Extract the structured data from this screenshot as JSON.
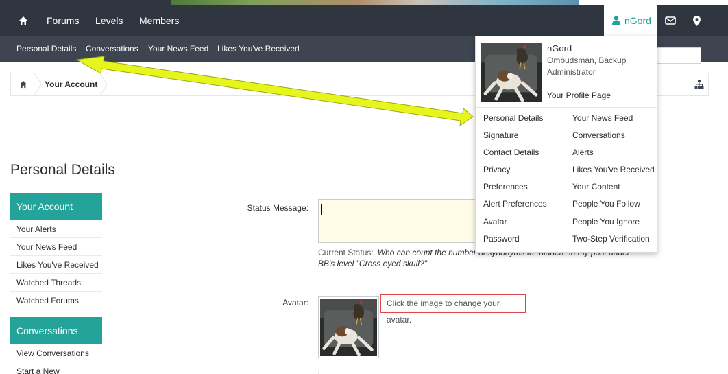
{
  "nav": {
    "items": [
      "Forums",
      "Levels",
      "Members"
    ],
    "user": "nGord"
  },
  "subnav": {
    "items": [
      "Personal Details",
      "Conversations",
      "Your News Feed",
      "Likes You've Received"
    ]
  },
  "breadcrumb": {
    "label": "Your Account"
  },
  "page": {
    "title": "Personal Details"
  },
  "sidebar": {
    "account": {
      "header": "Your Account",
      "links": [
        "Your Alerts",
        "Your News Feed",
        "Likes You've Received",
        "Watched Threads",
        "Watched Forums"
      ]
    },
    "conversations": {
      "header": "Conversations",
      "links": [
        "View Conversations",
        "Start a New"
      ]
    }
  },
  "form": {
    "status_label": "Status Message:",
    "status_value": "",
    "current_status_label": "Current Status:",
    "current_status_text": "Who can count the number of synonyms to \"hidden\" in my post under BB's level \"Cross eyed skull?\"",
    "avatar_label": "Avatar:",
    "avatar_hint": "Click the image to change your avatar."
  },
  "dropdown": {
    "name": "nGord",
    "role": "Ombudsman, Backup Administrator",
    "profile_link": "Your Profile Page",
    "left": [
      "Personal Details",
      "Signature",
      "Contact Details",
      "Privacy",
      "Preferences",
      "Alert Preferences",
      "Avatar",
      "Password"
    ],
    "right": [
      "Your News Feed",
      "Conversations",
      "Alerts",
      "Likes You've Received",
      "Your Content",
      "People You Follow",
      "People You Ignore",
      "Two-Step Verification"
    ]
  },
  "icons": {
    "home": "home-icon",
    "user": "user-icon",
    "inbox": "envelope-icon",
    "alerts": "map-marker-icon",
    "sitemap": "sitemap-icon"
  },
  "colors": {
    "nav_bg": "#2f3640",
    "subnav_bg": "#3e4550",
    "accent": "#24a39a",
    "arrow": "#e6f51c",
    "highlight_border": "#e0474c",
    "status_bg": "#fffde8"
  }
}
